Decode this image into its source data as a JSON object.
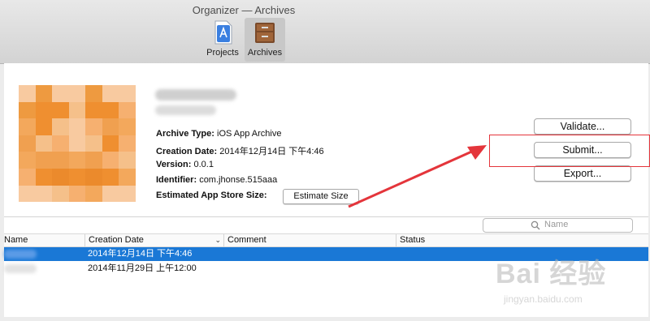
{
  "window": {
    "title": "Organizer — Archives"
  },
  "toolbar": {
    "projects_label": "Projects",
    "archives_label": "Archives"
  },
  "archive": {
    "type_label": "Archive Type:",
    "type_value": "iOS App Archive",
    "date_label": "Creation Date:",
    "date_value": "2014年12月14日 下午4:46",
    "version_label": "Version:",
    "version_value": "0.0.1",
    "identifier_label": "Identifier:",
    "identifier_value": "com.jhonse.515aaa",
    "size_label": "Estimated App Store Size:",
    "estimate_button": "Estimate Size"
  },
  "actions": {
    "validate": "Validate...",
    "submit": "Submit...",
    "export": "Export..."
  },
  "search": {
    "placeholder": "Name"
  },
  "table": {
    "columns": [
      "Name",
      "Creation Date",
      "Comment",
      "Status"
    ],
    "rows": [
      {
        "creation_date": "2014年12月14日 下午4:46",
        "selected": true
      },
      {
        "creation_date": "2014年11月29日 上午12:00",
        "selected": false
      }
    ]
  },
  "colors": {
    "accent": "#1a78d6",
    "annotation": "#e4353b"
  },
  "watermark": {
    "logo": "Bai 经验",
    "url": "jingyan.baidu.com"
  }
}
